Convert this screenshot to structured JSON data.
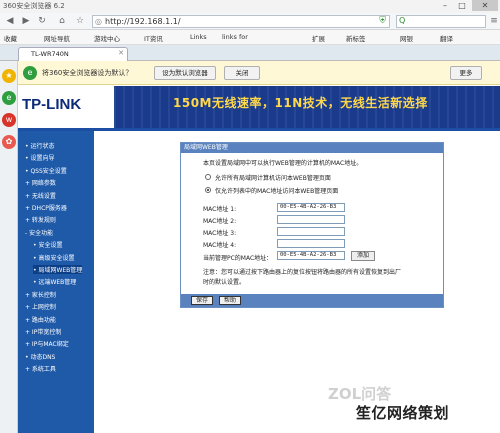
{
  "window": {
    "title": "360安全浏览器 6.2"
  },
  "toolbar": {
    "url": "http://192.168.1.1/"
  },
  "bookmarks": [
    "收藏",
    "网址导航",
    "游戏中心",
    "IT资讯",
    "Links",
    "links for",
    "扩展",
    "新标签",
    "网银",
    "翻译"
  ],
  "tab": {
    "title": "TL-WR740N"
  },
  "notify": {
    "text": "将360安全浏览器设为默认？",
    "default_btn": "设为默认浏览器",
    "close_btn": "关闭",
    "more_btn": "更多"
  },
  "banner": {
    "logo": "TP-LINK",
    "slogan": "150M无线速率，11N技术，无线生活新选择"
  },
  "menu": [
    {
      "label": "• 运行状态",
      "sub": false,
      "active": false
    },
    {
      "label": "• 设置向导",
      "sub": false,
      "active": false
    },
    {
      "label": "• QSS安全设置",
      "sub": false,
      "active": false
    },
    {
      "label": "+ 网络参数",
      "sub": false,
      "active": false
    },
    {
      "label": "+ 无线设置",
      "sub": false,
      "active": false
    },
    {
      "label": "+ DHCP服务器",
      "sub": false,
      "active": false
    },
    {
      "label": "+ 转发规则",
      "sub": false,
      "active": false
    },
    {
      "label": "- 安全功能",
      "sub": false,
      "active": false
    },
    {
      "label": "• 安全设置",
      "sub": true,
      "active": false
    },
    {
      "label": "• 高级安全设置",
      "sub": true,
      "active": false
    },
    {
      "label": "• 局域网WEB管理",
      "sub": true,
      "active": true
    },
    {
      "label": "• 远端WEB管理",
      "sub": true,
      "active": false
    },
    {
      "label": "+ 家长控制",
      "sub": false,
      "active": false
    },
    {
      "label": "+ 上网控制",
      "sub": false,
      "active": false
    },
    {
      "label": "+ 路由功能",
      "sub": false,
      "active": false
    },
    {
      "label": "+ IP带宽控制",
      "sub": false,
      "active": false
    },
    {
      "label": "+ IP与MAC绑定",
      "sub": false,
      "active": false
    },
    {
      "label": "• 动态DNS",
      "sub": false,
      "active": false
    },
    {
      "label": "+ 系统工具",
      "sub": false,
      "active": false
    }
  ],
  "panel": {
    "title": "局域网WEB管理",
    "desc": "本页设置局域网中可以执行WEB管理的计算机的MAC地址。",
    "radio_all": "允许所有局域网计算机访问本WEB管理页面",
    "radio_list": "仅允许列表中的MAC地址访问本WEB管理页面",
    "mac_labels": [
      "MAC地址 1:",
      "MAC地址 2:",
      "MAC地址 3:",
      "MAC地址 4:"
    ],
    "mac_values": [
      "00-E5-4B-A2-26-B3",
      "",
      "",
      ""
    ],
    "current_label": "当前管理PC的MAC地址：",
    "current_value": "00-E5-4B-A2-26-B3",
    "add_btn": "添加",
    "note1": "注意：您可以通过按下路由器上的复位按钮将路由器的所有设置恢复到出厂",
    "note2": "时的默认设置。",
    "save_btn": "保存",
    "help_btn": "帮助"
  },
  "watermark": {
    "line1": "ZOL问答",
    "line2": "笙亿网络策划"
  }
}
